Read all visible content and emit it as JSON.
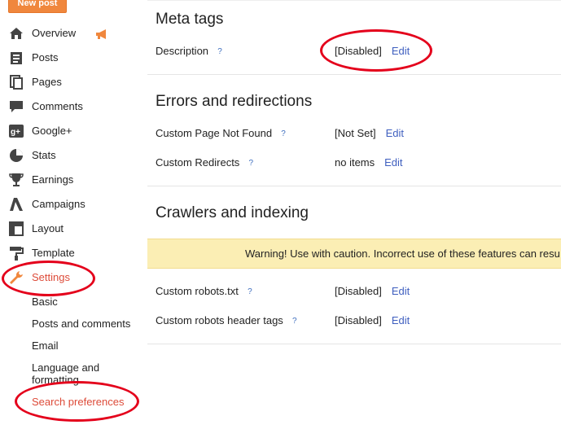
{
  "sidebar": {
    "new_post_label": "New post",
    "items": [
      {
        "label": "Overview",
        "icon": "home-icon"
      },
      {
        "label": "Posts",
        "icon": "posts-icon"
      },
      {
        "label": "Pages",
        "icon": "pages-icon"
      },
      {
        "label": "Comments",
        "icon": "comment-icon"
      },
      {
        "label": "Google+",
        "icon": "google-plus-icon"
      },
      {
        "label": "Stats",
        "icon": "stats-icon"
      },
      {
        "label": "Earnings",
        "icon": "trophy-icon"
      },
      {
        "label": "Campaigns",
        "icon": "adwords-icon"
      },
      {
        "label": "Layout",
        "icon": "layout-icon"
      },
      {
        "label": "Template",
        "icon": "paint-roller-icon"
      },
      {
        "label": "Settings",
        "icon": "wrench-icon"
      }
    ],
    "settings_sub": [
      {
        "label": "Basic"
      },
      {
        "label": "Posts and comments"
      },
      {
        "label": "Email"
      },
      {
        "label": "Language and formatting"
      },
      {
        "label": "Search preferences"
      }
    ]
  },
  "main": {
    "meta": {
      "title": "Meta tags",
      "rows": [
        {
          "label": "Description",
          "help": "?",
          "value": "[Disabled]",
          "edit": "Edit"
        }
      ]
    },
    "errors": {
      "title": "Errors and redirections",
      "rows": [
        {
          "label": "Custom Page Not Found",
          "help": "?",
          "value": "[Not Set]",
          "edit": "Edit"
        },
        {
          "label": "Custom Redirects",
          "help": "?",
          "value": "no items",
          "edit": "Edit"
        }
      ]
    },
    "crawlers": {
      "title": "Crawlers and indexing",
      "warning": "Warning! Use with caution. Incorrect use of these features can resu",
      "rows": [
        {
          "label": "Custom robots.txt",
          "help": "?",
          "value": "[Disabled]",
          "edit": "Edit"
        },
        {
          "label": "Custom robots header tags",
          "help": "?",
          "value": "[Disabled]",
          "edit": "Edit"
        }
      ]
    }
  },
  "colors": {
    "accent": "#dd4b39",
    "link": "#3f5fbf",
    "warning_bg": "#fbeeb4",
    "annotation": "#e4001b",
    "new_post": "#f0873d"
  }
}
